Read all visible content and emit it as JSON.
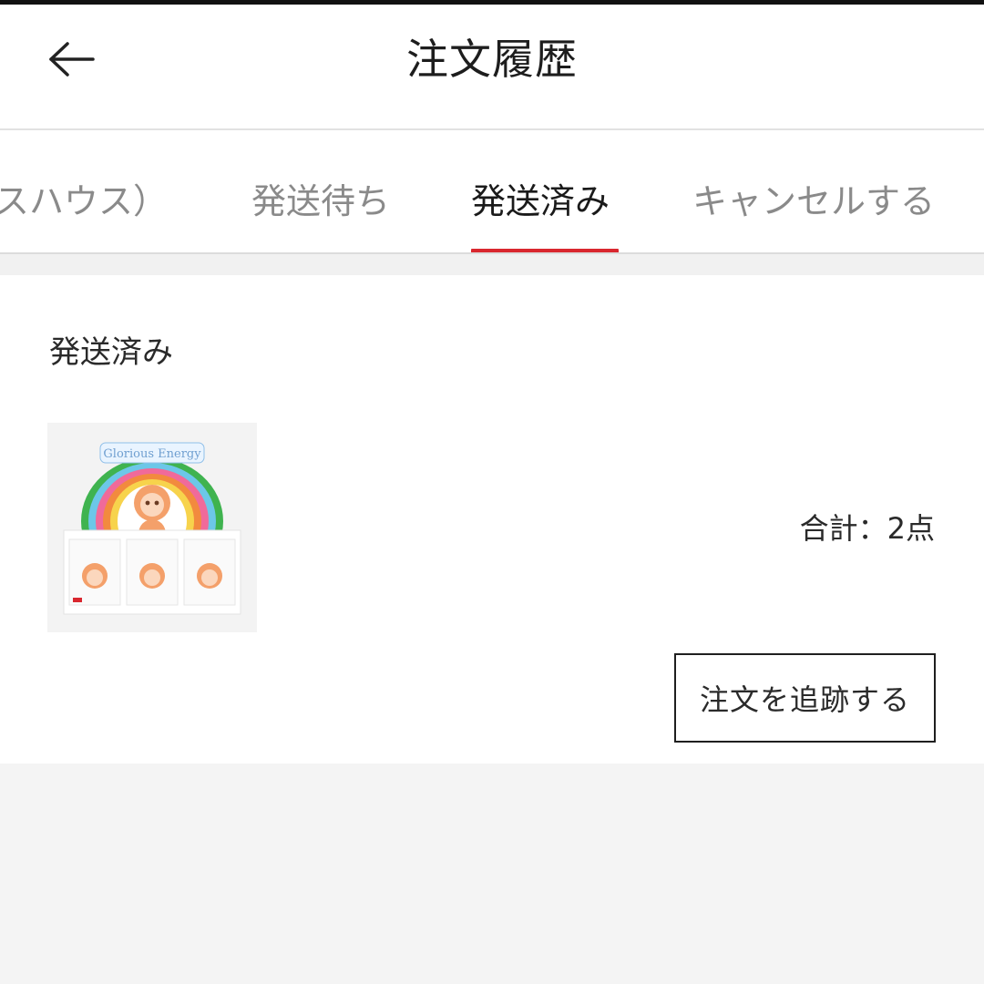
{
  "header": {
    "back_icon": "arrow-left-icon",
    "title": "注文履歴"
  },
  "tabs": [
    {
      "label": "スハウス）",
      "active": false
    },
    {
      "label": "発送待ち",
      "active": false
    },
    {
      "label": "発送済み",
      "active": true
    },
    {
      "label": "キャンセルする",
      "active": false
    }
  ],
  "order": {
    "status": "発送済み",
    "product_image": "product-box-image",
    "product_brand_text": "Glorious Energy",
    "total": "合計：2点",
    "track_button": "注文を追跡する"
  },
  "colors": {
    "accent": "#d9272f",
    "background": "#f4f4f4",
    "card": "#ffffff"
  }
}
